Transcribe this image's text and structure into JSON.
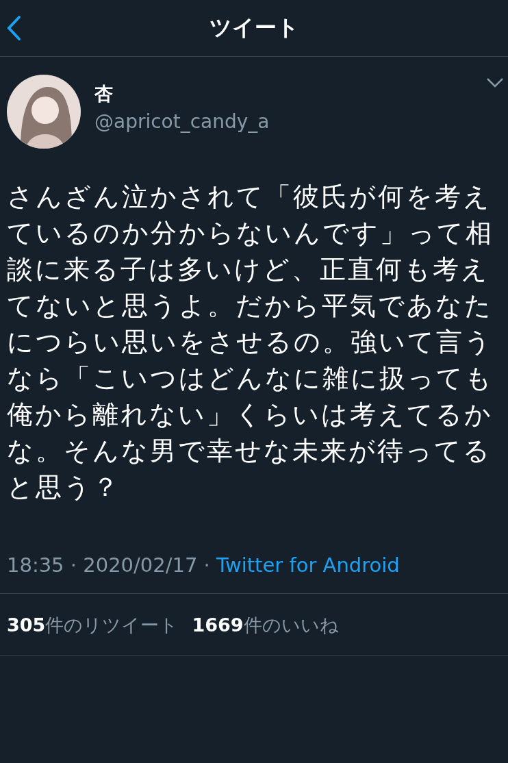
{
  "header": {
    "title": "ツイート"
  },
  "author": {
    "name": "杏",
    "handle": "@apricot_candy_a"
  },
  "body": "さんざん泣かされて「彼氏が何を考えているのか分からないんです」って相談に来る子は多いけど、正直何も考えてないと思うよ。だから平気であなたにつらい思いをさせるの。強いて言うなら「こいつはどんなに雑に扱っても俺から離れない」くらいは考えてるかな。そんな男で幸せな未来が待ってると思う？",
  "meta": {
    "time_date": "18:35 · 2020/02/17 ·",
    "source": "Twitter for Android"
  },
  "stats": [
    {
      "text": "**305**件のリツイート"
    },
    {
      "text": "**1669**件のいいね"
    }
  ]
}
